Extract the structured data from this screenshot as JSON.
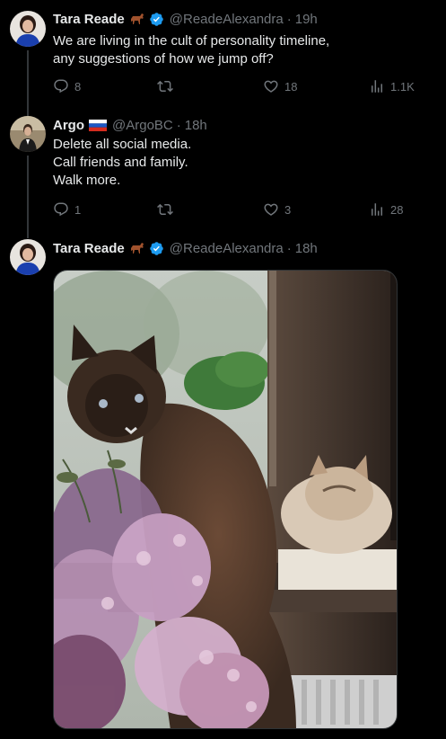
{
  "tweets": [
    {
      "name": "Tara Reade",
      "emoji": "horse",
      "verified": true,
      "handle": "@ReadeAlexandra",
      "time": "19h",
      "lines": [
        "We are living in the cult of personality timeline,",
        "any suggestions of how we jump off?"
      ],
      "stats": {
        "replies": "8",
        "retweets": "",
        "likes": "18",
        "views": "1.1K"
      }
    },
    {
      "name": "Argo",
      "emoji": "russia-flag",
      "verified": false,
      "handle": "@ArgoBC",
      "time": "18h",
      "lines": [
        "Delete all social media.",
        "Call friends and family.",
        "Walk more."
      ],
      "stats": {
        "replies": "1",
        "retweets": "",
        "likes": "3",
        "views": "28"
      }
    },
    {
      "name": "Tara Reade",
      "emoji": "horse",
      "verified": true,
      "handle": "@ReadeAlexandra",
      "time": "18h",
      "media": "photo of two cats by a window with lilac flowers"
    }
  ],
  "icons": {
    "reply": "reply-icon",
    "retweet": "retweet-icon",
    "like": "heart-icon",
    "views": "views-icon",
    "verified": "verified-badge-icon"
  },
  "colors": {
    "background": "#000000",
    "text": "#e7e9ea",
    "muted": "#71767b",
    "verified": "#1d9bf0",
    "thread_line": "#333639"
  }
}
